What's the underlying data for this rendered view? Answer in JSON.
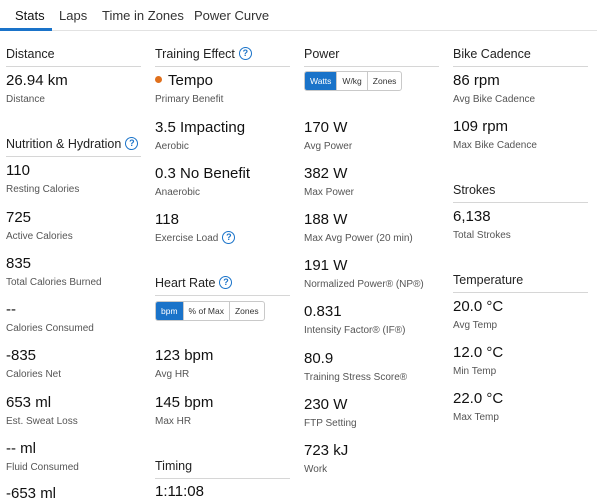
{
  "tabs": [
    "Stats",
    "Laps",
    "Time in Zones",
    "Power Curve"
  ],
  "distance": {
    "title": "Distance",
    "stats": [
      {
        "value": "26.94 km",
        "label": "Distance"
      }
    ]
  },
  "nutrition": {
    "title": "Nutrition & Hydration",
    "stats": [
      {
        "value": "110",
        "label": "Resting Calories"
      },
      {
        "value": "725",
        "label": "Active Calories"
      },
      {
        "value": "835",
        "label": "Total Calories Burned"
      },
      {
        "value": "--",
        "label": "Calories Consumed"
      },
      {
        "value": "-835",
        "label": "Calories Net"
      },
      {
        "value": "653 ml",
        "label": "Est. Sweat Loss"
      },
      {
        "value": "-- ml",
        "label": "Fluid Consumed"
      },
      {
        "value": "-653 ml",
        "label": ""
      }
    ]
  },
  "training_effect": {
    "title": "Training Effect",
    "stats": [
      {
        "value": "Tempo",
        "label": "Primary Benefit"
      },
      {
        "value": "3.5 Impacting",
        "label": "Aerobic"
      },
      {
        "value": "0.3 No Benefit",
        "label": "Anaerobic"
      },
      {
        "value": "118",
        "label": "Exercise Load"
      }
    ],
    "colors": {
      "tempo_dot": "#e0701c"
    }
  },
  "heart_rate": {
    "title": "Heart Rate",
    "units": [
      "bpm",
      "% of Max",
      "Zones"
    ],
    "selected_unit": "bpm",
    "stats": [
      {
        "value": "123 bpm",
        "label": "Avg HR"
      },
      {
        "value": "145 bpm",
        "label": "Max HR"
      }
    ]
  },
  "timing": {
    "title": "Timing",
    "stats": [
      {
        "value": "1:11:08",
        "label": ""
      }
    ]
  },
  "power": {
    "title": "Power",
    "units": [
      "Watts",
      "W/kg",
      "Zones"
    ],
    "selected_unit": "Watts",
    "stats": [
      {
        "value": "170 W",
        "label": "Avg Power"
      },
      {
        "value": "382 W",
        "label": "Max Power"
      },
      {
        "value": "188 W",
        "label": "Max Avg Power (20 min)"
      },
      {
        "value": "191 W",
        "label": "Normalized Power® (NP®)"
      },
      {
        "value": "0.831",
        "label": "Intensity Factor® (IF®)"
      },
      {
        "value": "80.9",
        "label": "Training Stress Score®"
      },
      {
        "value": "230 W",
        "label": "FTP Setting"
      },
      {
        "value": "723 kJ",
        "label": "Work"
      }
    ]
  },
  "cadence": {
    "title": "Bike Cadence",
    "stats": [
      {
        "value": "86 rpm",
        "label": "Avg Bike Cadence"
      },
      {
        "value": "109 rpm",
        "label": "Max Bike Cadence"
      }
    ]
  },
  "strokes": {
    "title": "Strokes",
    "stats": [
      {
        "value": "6,138",
        "label": "Total Strokes"
      }
    ]
  },
  "temperature": {
    "title": "Temperature",
    "stats": [
      {
        "value": "20.0 °C",
        "label": "Avg Temp"
      },
      {
        "value": "12.0 °C",
        "label": "Min Temp"
      },
      {
        "value": "22.0 °C",
        "label": "Max Temp"
      }
    ]
  },
  "colors": {
    "accent": "#1a73c9",
    "help_icon": "#1a73c9"
  }
}
